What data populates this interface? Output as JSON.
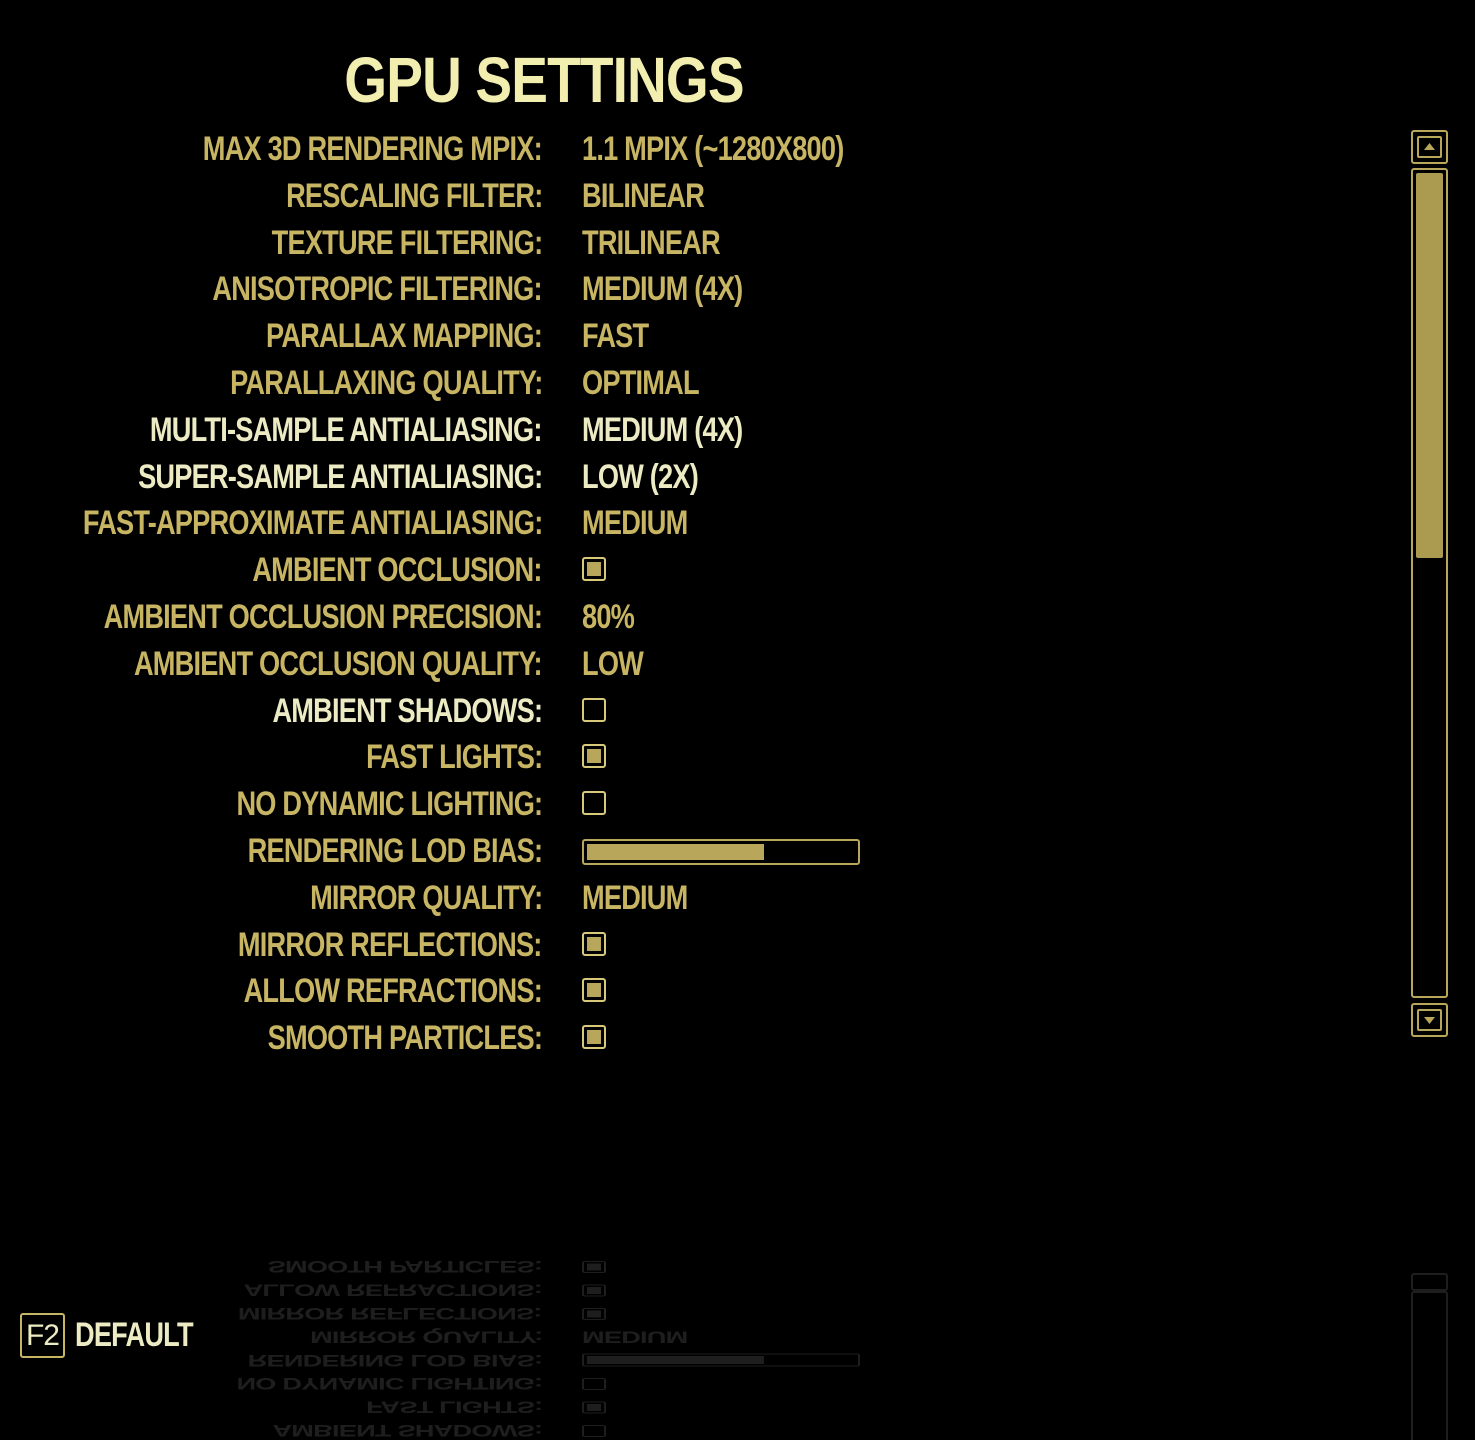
{
  "title": "GPU SETTINGS",
  "settings": [
    {
      "label": "MAX 3D RENDERING MPIX:",
      "type": "text",
      "value": "1.1 MPIX (~1280X800)",
      "highlight": false
    },
    {
      "label": "RESCALING FILTER:",
      "type": "text",
      "value": "BILINEAR",
      "highlight": false
    },
    {
      "label": "TEXTURE FILTERING:",
      "type": "text",
      "value": "TRILINEAR",
      "highlight": false
    },
    {
      "label": "ANISOTROPIC FILTERING:",
      "type": "text",
      "value": "MEDIUM (4X)",
      "highlight": false
    },
    {
      "label": "PARALLAX MAPPING:",
      "type": "text",
      "value": "FAST",
      "highlight": false
    },
    {
      "label": "PARALLAXING QUALITY:",
      "type": "text",
      "value": "OPTIMAL",
      "highlight": false
    },
    {
      "label": "MULTI-SAMPLE ANTIALIASING:",
      "type": "text",
      "value": "MEDIUM (4X)",
      "highlight": true
    },
    {
      "label": "SUPER-SAMPLE ANTIALIASING:",
      "type": "text",
      "value": "LOW (2X)",
      "highlight": true
    },
    {
      "label": "FAST-APPROXIMATE ANTIALIASING:",
      "type": "text",
      "value": "MEDIUM",
      "highlight": false
    },
    {
      "label": "AMBIENT OCCLUSION:",
      "type": "checkbox",
      "checked": true,
      "highlight": false
    },
    {
      "label": "AMBIENT OCCLUSION PRECISION:",
      "type": "text",
      "value": "80%",
      "highlight": false
    },
    {
      "label": "AMBIENT OCCLUSION QUALITY:",
      "type": "text",
      "value": "LOW",
      "highlight": false
    },
    {
      "label": "AMBIENT SHADOWS:",
      "type": "checkbox",
      "checked": false,
      "highlight": true
    },
    {
      "label": "FAST LIGHTS:",
      "type": "checkbox",
      "checked": true,
      "highlight": false
    },
    {
      "label": "NO DYNAMIC LIGHTING:",
      "type": "checkbox",
      "checked": false,
      "highlight": false
    },
    {
      "label": "RENDERING LOD BIAS:",
      "type": "slider",
      "fraction": 0.66,
      "highlight": false
    },
    {
      "label": "MIRROR QUALITY:",
      "type": "text",
      "value": "MEDIUM",
      "highlight": false
    },
    {
      "label": "MIRROR REFLECTIONS:",
      "type": "checkbox",
      "checked": true,
      "highlight": false
    },
    {
      "label": "ALLOW REFRACTIONS:",
      "type": "checkbox",
      "checked": true,
      "highlight": false
    },
    {
      "label": "SMOOTH PARTICLES:",
      "type": "checkbox",
      "checked": true,
      "highlight": false
    }
  ],
  "scrollbar": {
    "thumb_fraction": 0.47,
    "up_icon": "arrow-up-icon",
    "down_icon": "arrow-down-icon"
  },
  "footer": {
    "key": "F2",
    "label": "DEFAULT"
  },
  "colors": {
    "background": "#000000",
    "label": "#c7b563",
    "highlight": "#ecebc4",
    "title": "#f2eeb0",
    "accent": "#b8a75a"
  }
}
